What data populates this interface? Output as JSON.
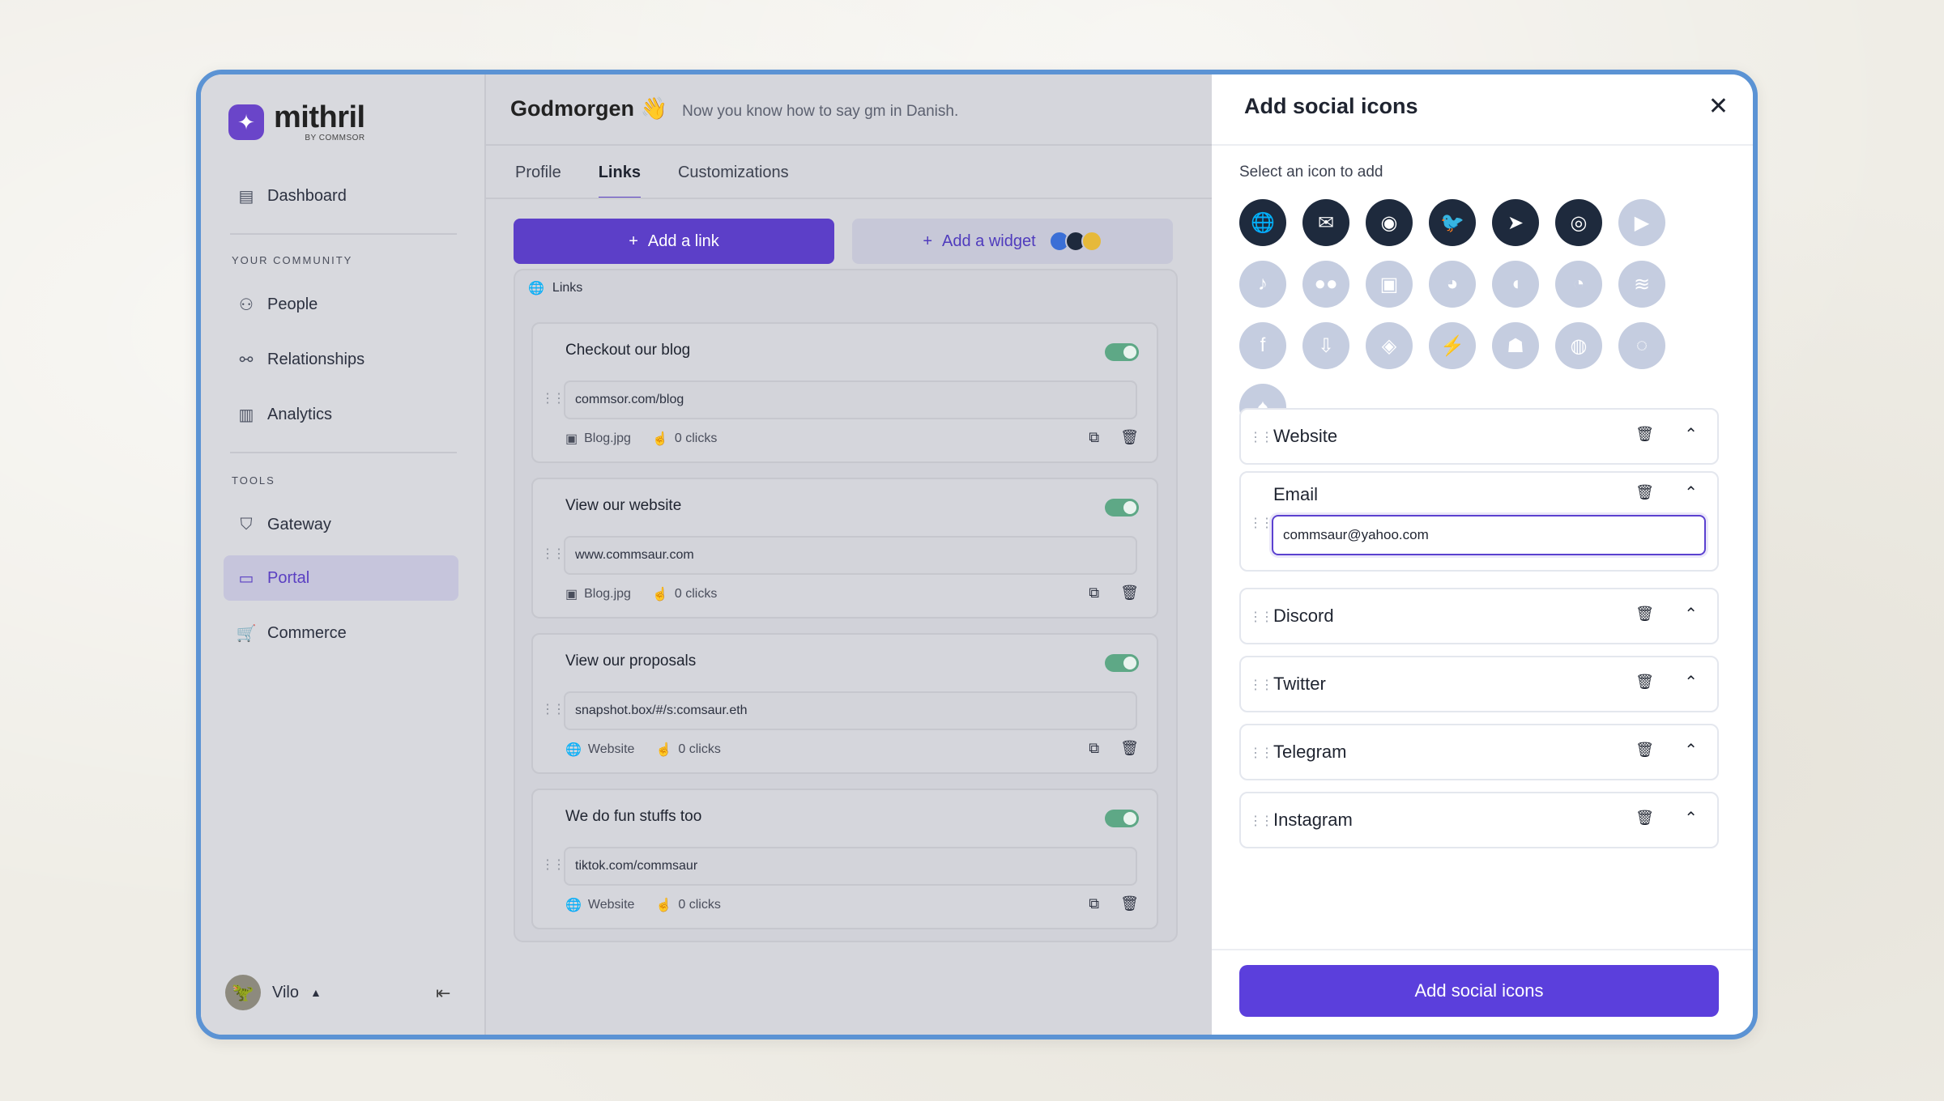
{
  "brand": {
    "name": "mithril",
    "sub": "BY COMMSOR"
  },
  "sidebar": {
    "dashboard": "Dashboard",
    "section_community": "YOUR COMMUNITY",
    "people": "People",
    "relationships": "Relationships",
    "analytics": "Analytics",
    "section_tools": "TOOLS",
    "gateway": "Gateway",
    "portal": "Portal",
    "commerce": "Commerce",
    "user": "Vilo"
  },
  "header": {
    "greeting": "Godmorgen",
    "emoji": "👋",
    "subtitle": "Now you know how to say gm in Danish."
  },
  "tabs": [
    "Profile",
    "Links",
    "Customizations"
  ],
  "buttons": {
    "add_link": "Add a link",
    "add_widget": "Add a widget"
  },
  "links_panel": {
    "title": "Links",
    "cards": [
      {
        "title": "Checkout our blog",
        "url": "commsor.com/blog",
        "thumb": "Blog.jpg",
        "clicks": "0 clicks",
        "enabled": true
      },
      {
        "title": "View our website",
        "url": "www.commsaur.com",
        "thumb": "Blog.jpg",
        "clicks": "0 clicks",
        "enabled": true
      },
      {
        "title": "View our proposals",
        "url": "snapshot.box/#/s:comsaur.eth",
        "thumb": "Website",
        "clicks": "0 clicks",
        "enabled": true
      },
      {
        "title": "We do fun stuffs too",
        "url": "tiktok.com/commsaur",
        "thumb": "Website",
        "clicks": "0 clicks",
        "enabled": true
      }
    ]
  },
  "drawer": {
    "title": "Add social icons",
    "subtitle": "Select an icon to add",
    "icons": [
      {
        "name": "globe-icon",
        "glyph": "🌐",
        "selected": true
      },
      {
        "name": "email-icon",
        "glyph": "✉",
        "selected": true
      },
      {
        "name": "discord-icon",
        "glyph": "◉",
        "selected": true
      },
      {
        "name": "twitter-icon",
        "glyph": "🐦",
        "selected": true
      },
      {
        "name": "telegram-icon",
        "glyph": "➤",
        "selected": true
      },
      {
        "name": "instagram-icon",
        "glyph": "◎",
        "selected": true
      },
      {
        "name": "youtube-icon",
        "glyph": "▶",
        "selected": false
      },
      {
        "name": "tiktok-icon",
        "glyph": "♪",
        "selected": false
      },
      {
        "name": "medium-icon",
        "glyph": "●●",
        "selected": false
      },
      {
        "name": "twitch-icon",
        "glyph": "▣",
        "selected": false
      },
      {
        "name": "reddit-icon",
        "glyph": "◕",
        "selected": false
      },
      {
        "name": "patreon-icon",
        "glyph": "◖",
        "selected": false
      },
      {
        "name": "github-icon",
        "glyph": "◔",
        "selected": false
      },
      {
        "name": "spotify-icon",
        "glyph": "≋",
        "selected": false
      },
      {
        "name": "facebook-icon",
        "glyph": "f",
        "selected": false
      },
      {
        "name": "download-icon",
        "glyph": "⇩",
        "selected": false
      },
      {
        "name": "eye-icon",
        "glyph": "◈",
        "selected": false
      },
      {
        "name": "lightning-icon",
        "glyph": "⚡",
        "selected": false
      },
      {
        "name": "ghost-icon",
        "glyph": "☗",
        "selected": false
      },
      {
        "name": "chart-icon",
        "glyph": "◍",
        "selected": false
      },
      {
        "name": "chat-icon",
        "glyph": "◌",
        "selected": false
      },
      {
        "name": "mushroom-icon",
        "glyph": "♠",
        "selected": false
      }
    ],
    "items": [
      {
        "name": "Website"
      },
      {
        "name": "Email",
        "value": "commsaur@yahoo.com"
      },
      {
        "name": "Discord"
      },
      {
        "name": "Twitter"
      },
      {
        "name": "Telegram"
      },
      {
        "name": "Instagram"
      }
    ],
    "submit": "Add social icons"
  },
  "colors": {
    "accent": "#5b3fdc",
    "toggle": "#5ea886",
    "frame": "#5b93d4",
    "icon_selected": "#1e2a3d",
    "icon_unselected": "#c5cde0"
  }
}
